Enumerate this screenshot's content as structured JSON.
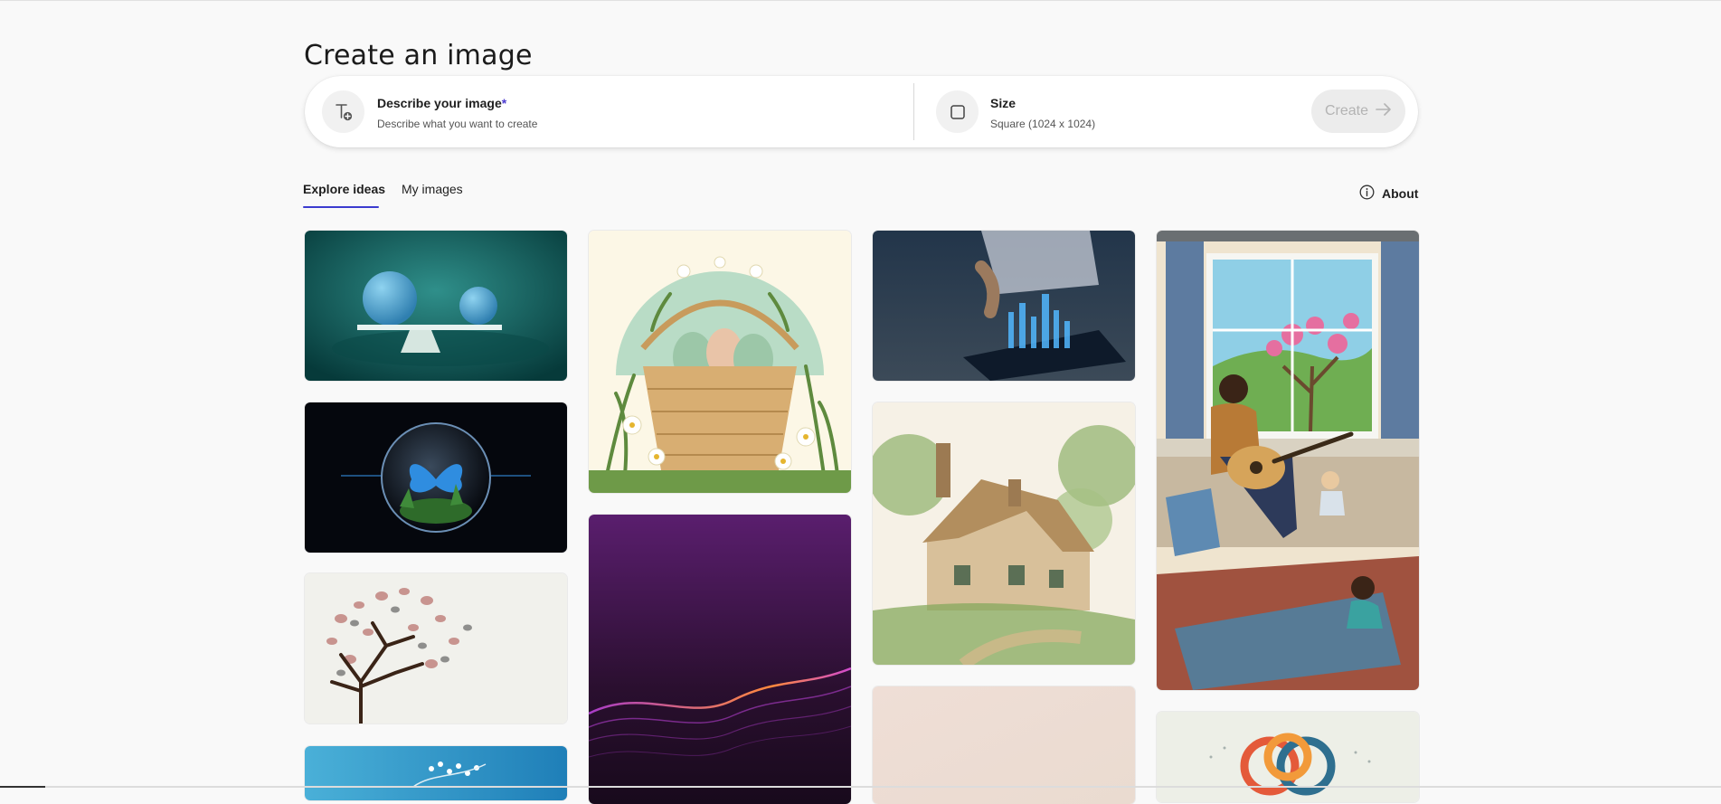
{
  "page": {
    "title": "Create an image"
  },
  "prompt_bar": {
    "describe_label": "Describe your image",
    "required_mark": "*",
    "describe_sub": "Describe what you want to create",
    "describe_icon": "text-add-icon",
    "size_label": "Size",
    "size_value": "Square (1024 x 1024)",
    "size_icon": "square-icon",
    "create_label": "Create",
    "create_icon": "arrow-right-icon"
  },
  "tabs": [
    {
      "label": "Explore ideas",
      "active": true
    },
    {
      "label": "My images",
      "active": false
    }
  ],
  "about": {
    "label": "About",
    "icon": "info-icon"
  },
  "gallery": [
    {
      "name": "balance-spheres-image",
      "description": "two blue spheres balancing on a board"
    },
    {
      "name": "butterfly-orb-image",
      "description": "blue butterfly inside a glass bubble with ferns"
    },
    {
      "name": "petal-tree-image",
      "description": "tree with pink and grey petal leaves"
    },
    {
      "name": "blue-blossom-image",
      "description": "white blossoms on blue background"
    },
    {
      "name": "easter-basket-image",
      "description": "woven basket of pastel eggs with daisies"
    },
    {
      "name": "purple-wave-image",
      "description": "glowing particle wave on purple gradient"
    },
    {
      "name": "hologram-tablet-image",
      "description": "hand drawing on tablet with holographic city"
    },
    {
      "name": "watercolor-cottage-image",
      "description": "watercolor stone cottage among trees"
    },
    {
      "name": "pastel-card-image",
      "description": "pale peach gradient"
    },
    {
      "name": "guitar-father-image",
      "description": "man playing guitar for two children by a window"
    },
    {
      "name": "knot-logo-image",
      "description": "colorful interlocking knot"
    }
  ],
  "colors": {
    "accent": "#3b3bcf",
    "background": "#f9f9f9"
  }
}
